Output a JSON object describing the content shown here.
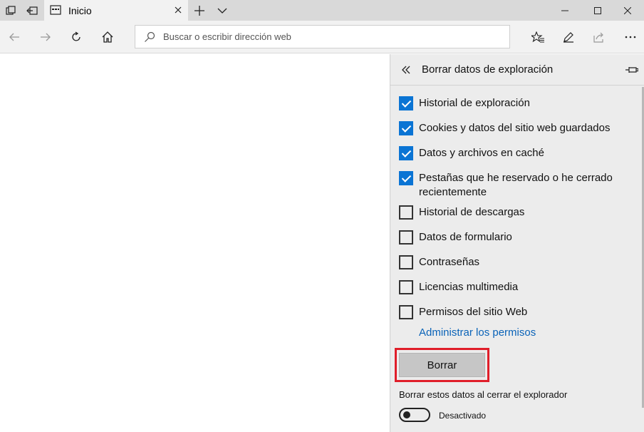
{
  "tab": {
    "title": "Inicio"
  },
  "address_bar": {
    "placeholder": "Buscar o escribir dirección web"
  },
  "panel": {
    "title": "Borrar datos de exploración",
    "options": [
      {
        "label": "Historial de exploración",
        "checked": true
      },
      {
        "label": "Cookies y datos del sitio web guardados",
        "checked": true
      },
      {
        "label": "Datos y archivos en caché",
        "checked": true
      },
      {
        "label": "Pestañas que he reservado o he cerrado recientemente",
        "checked": true
      },
      {
        "label": "Historial de descargas",
        "checked": false
      },
      {
        "label": "Datos de formulario",
        "checked": false
      },
      {
        "label": "Contraseñas",
        "checked": false
      },
      {
        "label": "Licencias multimedia",
        "checked": false
      },
      {
        "label": "Permisos del sitio Web",
        "checked": false
      }
    ],
    "manage_link": "Administrar los permisos",
    "clear_button": "Borrar",
    "toggle_caption": "Borrar estos datos al cerrar el explorador",
    "toggle_state": "Desactivado",
    "toggle_on": false
  },
  "colors": {
    "accent": "#0a74d4",
    "highlight": "#e01e2a",
    "link": "#0a63b8"
  },
  "icons": {
    "tab_actions": [
      "tab-preview-icon",
      "set-aside-tabs-icon"
    ],
    "tab": [
      "page-icon",
      "close-icon"
    ],
    "tab_bar": [
      "new-tab-icon",
      "chevron-down-icon"
    ],
    "window": [
      "minimize-icon",
      "maximize-icon",
      "close-icon"
    ],
    "nav": [
      "back-icon",
      "forward-icon",
      "refresh-icon",
      "home-icon",
      "search-icon"
    ],
    "toolbar": [
      "favorites-icon",
      "web-note-icon",
      "share-icon",
      "more-icon"
    ],
    "panel": [
      "chevron-left-double-icon",
      "pin-icon"
    ]
  }
}
